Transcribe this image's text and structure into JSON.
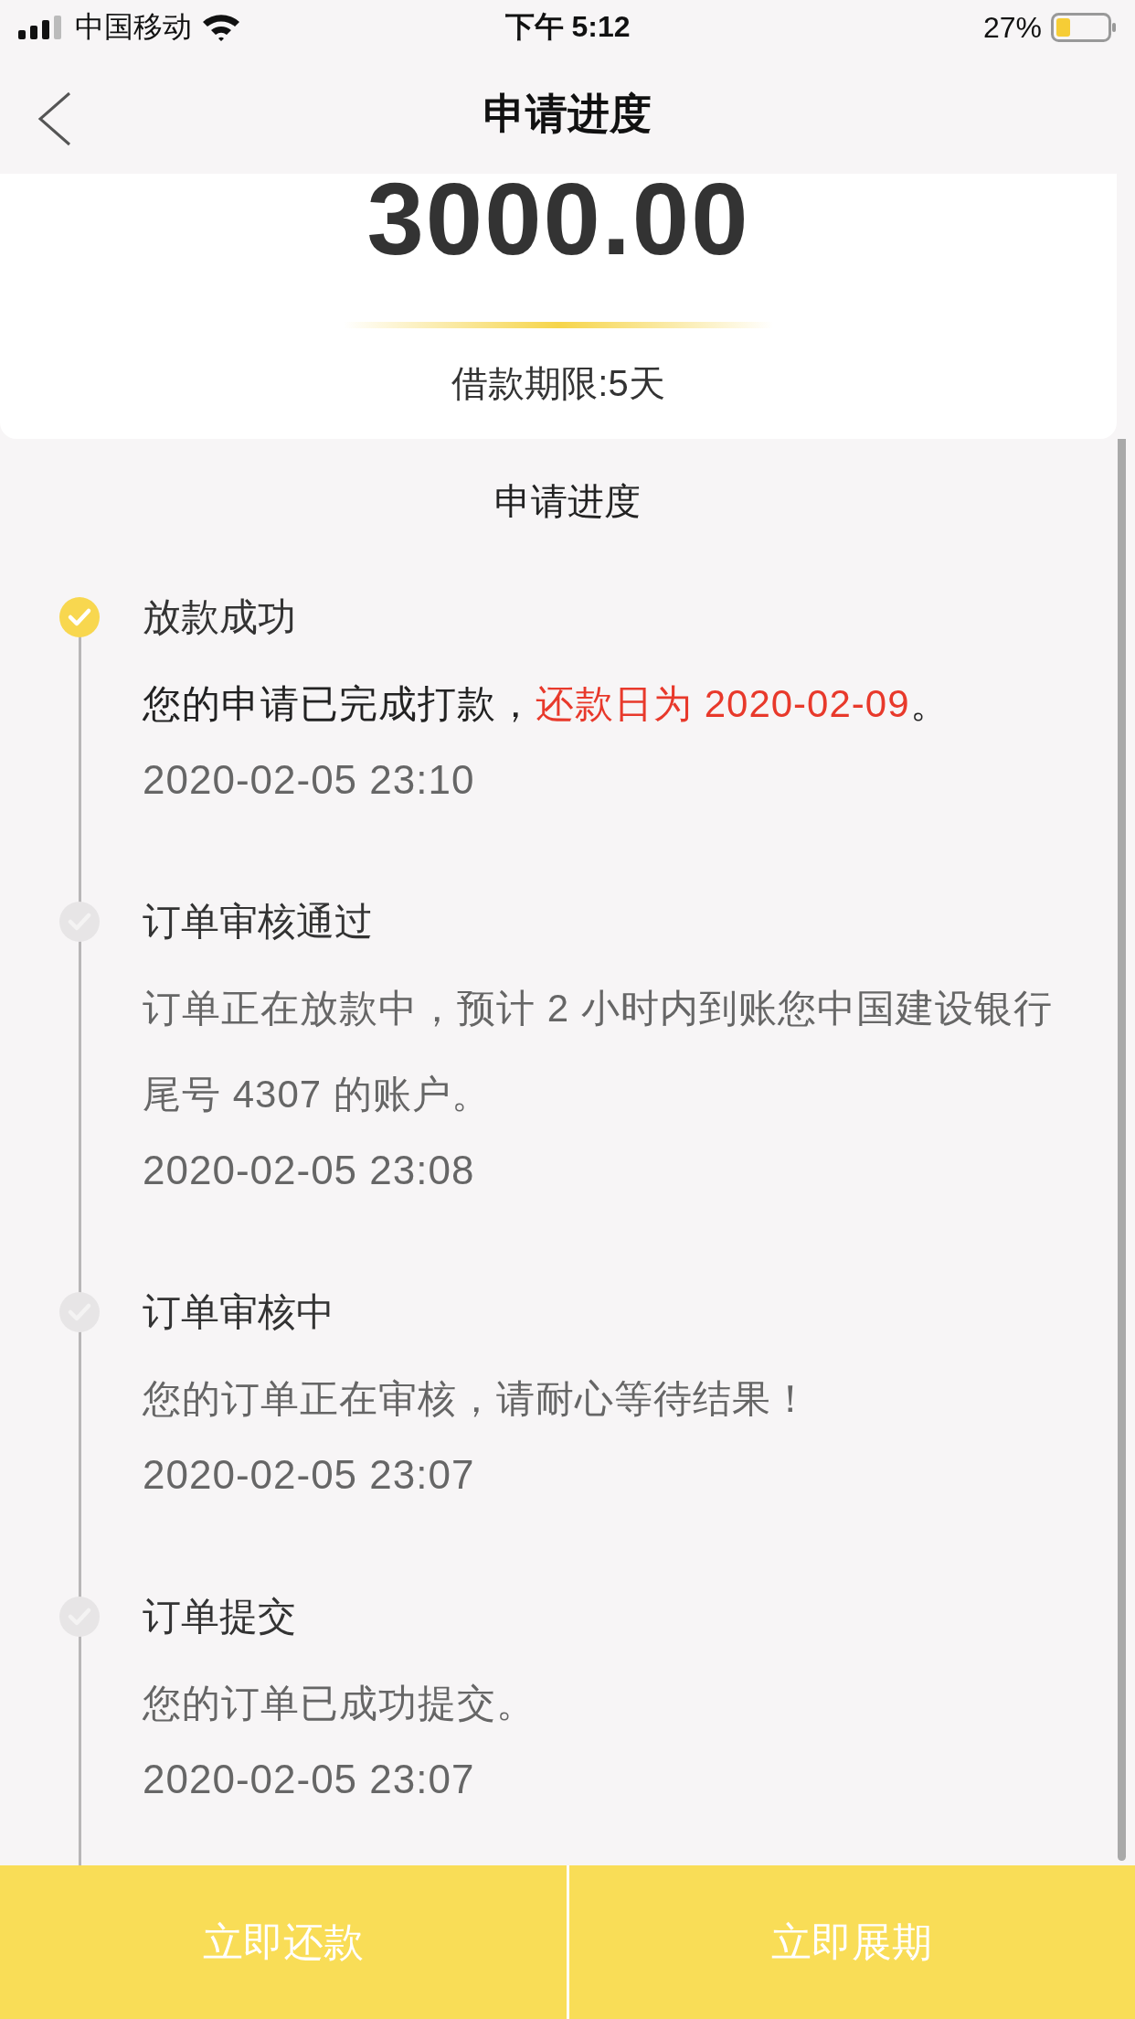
{
  "status_bar": {
    "carrier": "中国移动",
    "time": "下午 5:12",
    "battery": "27%"
  },
  "nav": {
    "title": "申请进度"
  },
  "loan": {
    "amount": "3000.00",
    "term": "借款期限:5天"
  },
  "progress": {
    "title": "申请进度",
    "steps": [
      {
        "title": "放款成功",
        "active": true,
        "description": [
          {
            "text": "您的申请已完成打款，",
            "highlight": false
          },
          {
            "text": "还款日为 2020-02-09",
            "highlight": true
          },
          {
            "text": "。",
            "highlight": false
          }
        ],
        "time": "2020-02-05 23:10"
      },
      {
        "title": "订单审核通过",
        "active": false,
        "description": [
          {
            "text": "订单正在放款中，预计 2 小时内到账您中国建设银行尾号 4307 的账户。",
            "highlight": false
          }
        ],
        "time": "2020-02-05 23:08"
      },
      {
        "title": "订单审核中",
        "active": false,
        "description": [
          {
            "text": "您的订单正在审核，请耐心等待结果！",
            "highlight": false
          }
        ],
        "time": "2020-02-05 23:07"
      },
      {
        "title": "订单提交",
        "active": false,
        "description": [
          {
            "text": "您的订单已成功提交。",
            "highlight": false
          }
        ],
        "time": "2020-02-05 23:07"
      }
    ]
  },
  "actions": [
    {
      "label": "立即还款"
    },
    {
      "label": "立即展期"
    }
  ]
}
